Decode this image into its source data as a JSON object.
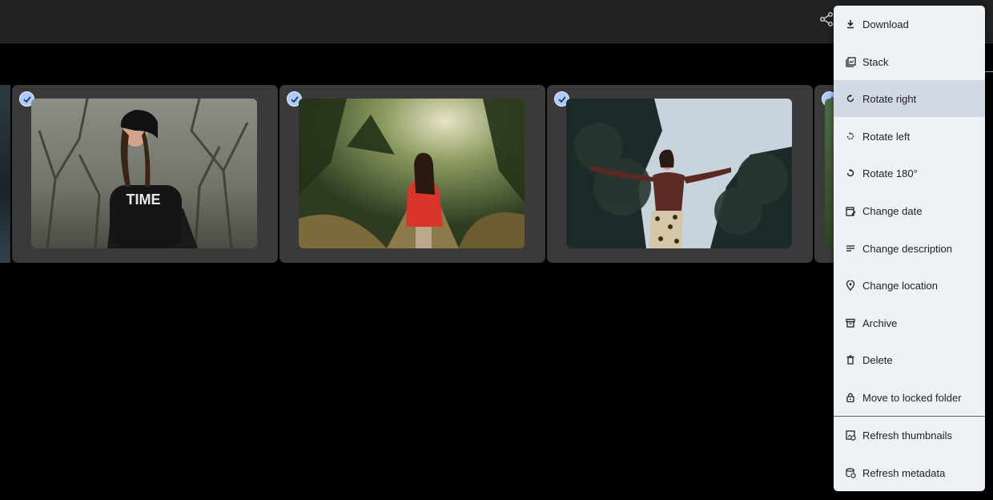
{
  "toolbar": {
    "share_icon": "share-icon"
  },
  "photos": [
    {
      "name": "woman-in-beanie",
      "selected": true
    },
    {
      "name": "woman-hiking-forest",
      "selected": true
    },
    {
      "name": "woman-arms-outstretched",
      "selected": true
    }
  ],
  "menu": {
    "items": [
      {
        "label": "Download",
        "icon": "download-icon"
      },
      {
        "label": "Stack",
        "icon": "stack-icon"
      },
      {
        "label": "Rotate right",
        "icon": "rotate-right-icon",
        "active": true
      },
      {
        "label": "Rotate left",
        "icon": "rotate-left-icon"
      },
      {
        "label": "Rotate 180°",
        "icon": "rotate-180-icon"
      },
      {
        "label": "Change date",
        "icon": "calendar-edit-icon"
      },
      {
        "label": "Change description",
        "icon": "description-icon"
      },
      {
        "label": "Change location",
        "icon": "location-icon"
      },
      {
        "label": "Archive",
        "icon": "archive-icon"
      },
      {
        "label": "Delete",
        "icon": "trash-icon"
      },
      {
        "label": "Move to locked folder",
        "icon": "lock-icon"
      },
      {
        "label": "Refresh thumbnails",
        "icon": "refresh-thumbnails-icon"
      },
      {
        "label": "Refresh metadata",
        "icon": "refresh-metadata-icon"
      }
    ]
  },
  "colors": {
    "topbar": "#212121",
    "tile": "#3a3a3a",
    "check": "#aecbfa",
    "menu_bg": "#eef1f5",
    "menu_active": "#d2d9e6"
  }
}
